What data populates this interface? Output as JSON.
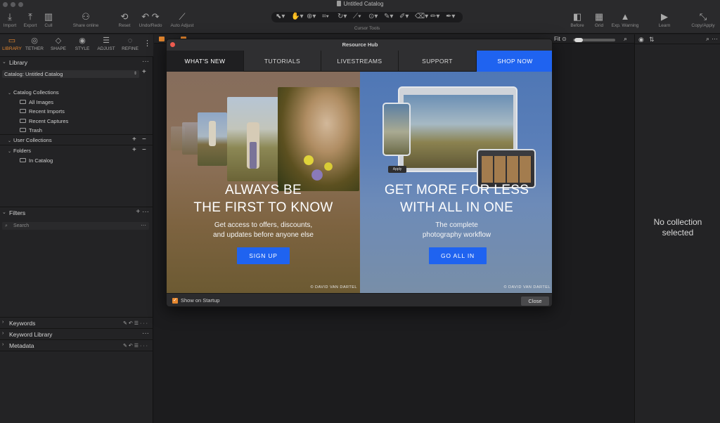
{
  "window": {
    "title": "Untitled Catalog"
  },
  "toolbar": {
    "import": "Import",
    "export": "Export",
    "cull": "Cull",
    "share_online": "Share online",
    "reset": "Reset",
    "undo_redo": "Undo/Redo",
    "auto_adjust": "Auto Adjust",
    "cursor_tools": "Cursor Tools",
    "before": "Before",
    "grid": "Grid",
    "exp_warning": "Exp. Warning",
    "learn": "Learn",
    "copy_apply": "Copy/Apply"
  },
  "tool_tabs": [
    {
      "label": "LIBRARY",
      "icon": "folder-icon",
      "active": true
    },
    {
      "label": "TETHER",
      "icon": "camera-icon"
    },
    {
      "label": "SHAPE",
      "icon": "shape-icon"
    },
    {
      "label": "STYLE",
      "icon": "style-icon"
    },
    {
      "label": "ADJUST",
      "icon": "sliders-icon"
    },
    {
      "label": "REFINE",
      "icon": "refine-icon"
    }
  ],
  "library": {
    "heading": "Library",
    "catalog_select": "Catalog: Untitled Catalog",
    "catalog_collections": "Catalog Collections",
    "items": [
      "All Images",
      "Recent Imports",
      "Recent Captures",
      "Trash"
    ],
    "user_collections": "User Collections",
    "folders": "Folders",
    "in_catalog": "In Catalog"
  },
  "filters": {
    "heading": "Filters",
    "search_placeholder": "Search"
  },
  "bottom_sections": [
    "Keywords",
    "Keyword Library",
    "Metadata"
  ],
  "viewer": {
    "fit_label": "Fit"
  },
  "right_panel": {
    "empty_line1": "No collection",
    "empty_line2": "selected"
  },
  "modal": {
    "title": "Resource Hub",
    "tabs": [
      "WHAT'S NEW",
      "TUTORIALS",
      "LIVESTREAMS",
      "SUPPORT",
      "SHOP NOW"
    ],
    "left": {
      "headline_1": "ALWAYS BE",
      "headline_2": "THE FIRST TO KNOW",
      "sub_1": "Get access to offers, discounts,",
      "sub_2": "and updates before anyone else",
      "cta": "SIGN UP",
      "credit": "© DAVID VAN DARTEL"
    },
    "right": {
      "headline_1": "GET MORE FOR LESS",
      "headline_2": "WITH ALL IN ONE",
      "sub_1": "The complete",
      "sub_2": "photography workflow",
      "cta": "GO ALL IN",
      "credit": "© DAVID VAN DARTEL",
      "apply_label": "Apply"
    },
    "show_on_startup": "Show on Startup",
    "show_on_startup_checked": true,
    "close": "Close"
  },
  "colors": {
    "accent_orange": "#e7882f",
    "cta_blue": "#1f63f0",
    "close_dot": "#ee5b4f"
  }
}
